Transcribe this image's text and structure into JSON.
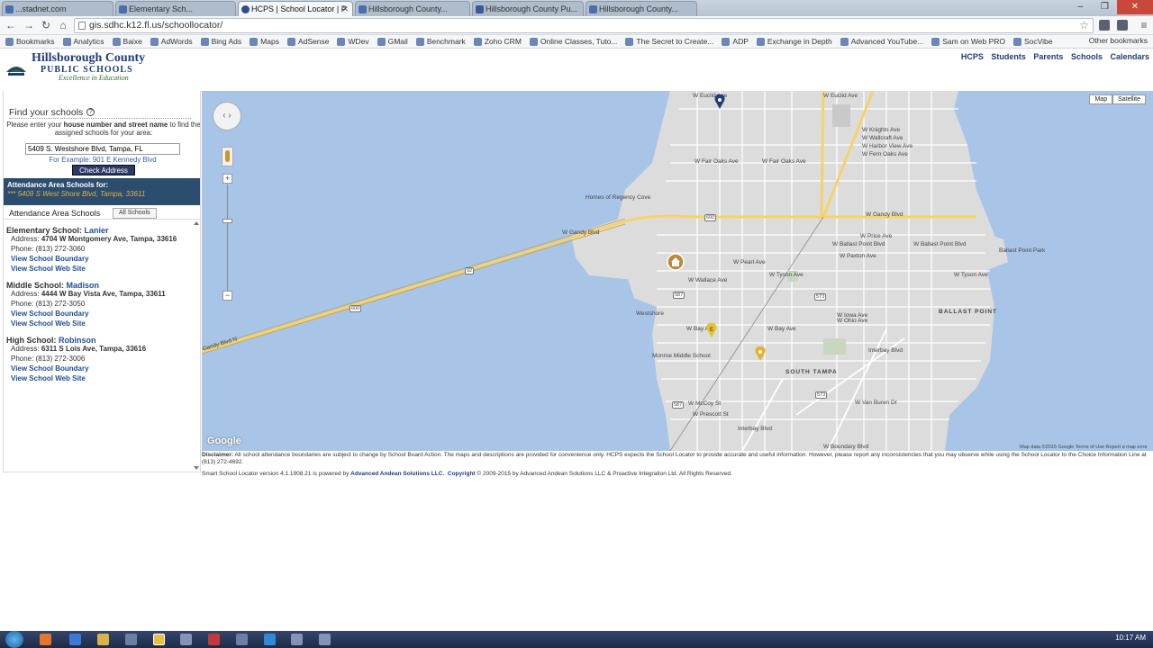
{
  "browser": {
    "tabs": [
      {
        "label": "...stadnet.com"
      },
      {
        "label": "Elementary Sch..."
      },
      {
        "label": "HCPS | School Locator | P"
      },
      {
        "label": "Hillsborough County..."
      },
      {
        "label": "Hillsborough County Pu..."
      },
      {
        "label": ""
      },
      {
        "label": "Hillsborough County..."
      }
    ],
    "url": "gis.sdhc.k12.fl.us/schoollocator/",
    "bookmarks": [
      "Bookmarks",
      "Analytics",
      "Baixe",
      "AdWords",
      "Bing Ads",
      "Maps",
      "AdSense",
      "WDev",
      "GMail",
      "Benchmark",
      "Zoho CRM",
      "Online Classes, Tuto...",
      "The Secret to Create...",
      "ADP",
      "Exchange in Depth",
      "Advanced YouTube...",
      "Sam on Web PRO",
      "SocVibe"
    ],
    "other_bookmarks": "Other bookmarks"
  },
  "site": {
    "logo_line1": "Hillsborough County",
    "logo_line2": "PUBLIC SCHOOLS",
    "logo_line3": "Excellence in Education",
    "nav": [
      "HCPS",
      "Students",
      "Parents",
      "Schools",
      "Calendars"
    ]
  },
  "finder": {
    "title": "Find your schools",
    "instructions_pre": "Please enter your ",
    "instructions_bold": "house number and street name",
    "instructions_post": " to find the assigned schools for your area:",
    "address_value": "5409 S. Westshore Blvd, Tampa, FL",
    "example": "For Example: 901 E Kennedy Blvd",
    "check_button": "Check Address",
    "banner_title": "Attendance Area Schools for:",
    "banner_address": "*** 5409 S West Shore Blvd, Tampa, 33611",
    "tab_attendance": "Attendance Area Schools",
    "tab_all": "All Schools"
  },
  "schools": [
    {
      "level": "Elementary School:",
      "name": "Lanier",
      "address_label": "Address:",
      "address": "4704 W Montgomery Ave, Tampa, 33616",
      "phone": "Phone: (813) 272-3060",
      "boundary": "View School Boundary",
      "website": "View School Web Site"
    },
    {
      "level": "Middle School:",
      "name": "Madison",
      "address_label": "Address:",
      "address": "4444 W Bay Vista Ave, Tampa, 33611",
      "phone": "Phone: (813) 272-3050",
      "boundary": "View School Boundary",
      "website": "View School Web Site"
    },
    {
      "level": "High School:",
      "name": "Robinson",
      "address_label": "Address:",
      "address": "6311 S Lois Ave, Tampa, 33616",
      "phone": "Phone: (813) 272-3006",
      "boundary": "View School Boundary",
      "website": "View School Web Site"
    }
  ],
  "map": {
    "type_map": "Map",
    "type_satellite": "Satellite",
    "google": "Google",
    "credits": "Map data ©2015 Google   Terms of Use   Report a map error",
    "labels": [
      "W Euclid Ave",
      "W Euclid Ave",
      "W Fair Oaks Ave",
      "W Fair Oaks Ave",
      "W Knights Ave",
      "W Wallcraft Ave",
      "W Harbor View Ave",
      "W Fern Oaks Ave",
      "Homes of Regency Cove",
      "W Gandy Blvd",
      "W Gandy Blvd",
      "W Price Ave",
      "W Ballast Point Blvd",
      "W Ballast Point Blvd",
      "Ballast Point Park",
      "W Paxton Ave",
      "W Pearl Ave",
      "W Wallace Ave",
      "W Tyson Ave",
      "W Tyson Ave",
      "Westshore",
      "W Bay Ave",
      "W Bay Ave",
      "BALLAST POINT",
      "Monroe Middle School",
      "SOUTH TAMPA",
      "W McCoy St",
      "W Prescott St",
      "Interbay Blvd",
      "W Van Buren Dr",
      "W Ohio Ave",
      "W Iowa Ave",
      "Gandy Blvd N",
      "W Boundary Blvd",
      "Interbay Blvd"
    ],
    "route_badges": [
      "600",
      "92",
      "600",
      "573",
      "573",
      "587",
      "587"
    ]
  },
  "footer": {
    "disclaimer_label": "Disclaimer:",
    "disclaimer": " All school attendance boundaries are subject to change by School Board Action. The maps and descriptions are provided for convenience only. HCPS expects the School Locator to provide accurate and useful information. However, please report any inconsistencies that you may observe while using the School Locator to the Choice Information Line at (813) 272-4692.",
    "powered_pre": "Smart School Locator version 4.1.1908.21 is powered by ",
    "powered_company": "Advanced Andean Solutions LLC.",
    "copyright_label": "Copyright",
    "copyright": " © 2009-2015 by Advanced Andean Solutions LLC & Proactive Integration Ltd.  All Rights Reserved."
  },
  "taskbar": {
    "time": "10:17 AM"
  }
}
